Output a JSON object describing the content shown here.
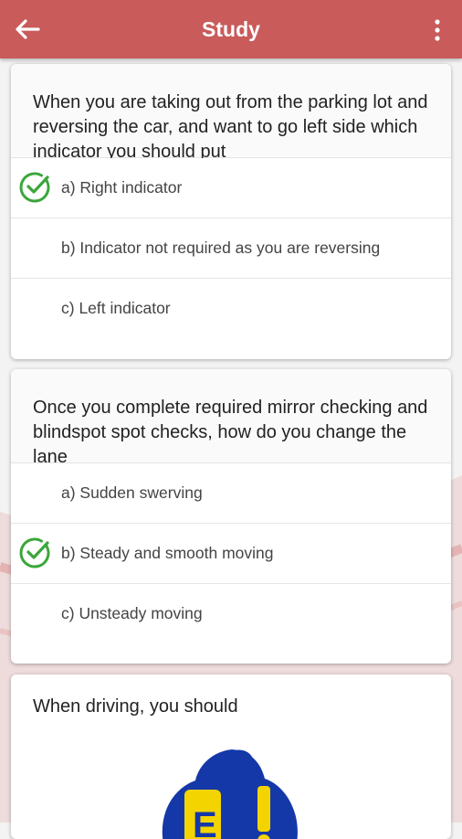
{
  "appbar": {
    "title": "Study",
    "back_icon": "arrow-left-icon",
    "menu_icon": "more-vert-icon",
    "color": "#c95b5b"
  },
  "questions": [
    {
      "text": "When you are taking out from the parking lot and reversing the car, and want to go left side which indicator you should put",
      "options": [
        {
          "label": "a) Right indicator",
          "correct": true
        },
        {
          "label": "b) Indicator not required as you are reversing",
          "correct": false
        },
        {
          "label": "c) Left indicator",
          "correct": false
        }
      ]
    },
    {
      "text": "Once you complete required mirror checking and blindspot spot checks, how do you change the lane",
      "options": [
        {
          "label": "a) Sudden swerving",
          "correct": false
        },
        {
          "label": "b) Steady and smooth moving",
          "correct": true
        },
        {
          "label": "c) Unsteady moving",
          "correct": false
        }
      ]
    },
    {
      "text": "When driving, you should"
    }
  ],
  "colors": {
    "check": "#3aa63a",
    "accent": "#c95b5b"
  }
}
